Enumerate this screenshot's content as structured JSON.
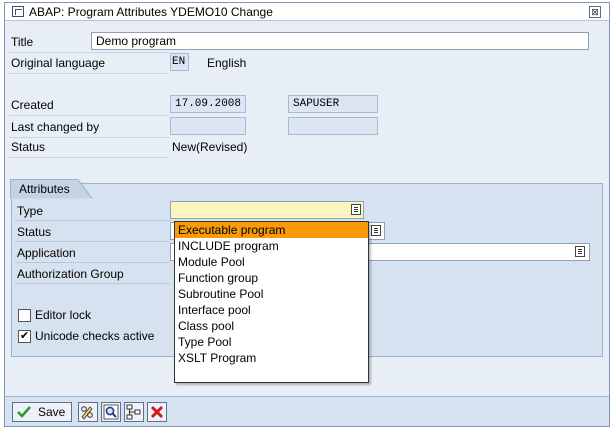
{
  "window": {
    "title": "ABAP: Program Attributes YDEMO10 Change",
    "close_glyph": "⊠"
  },
  "header_fields": {
    "title_label": "Title",
    "title_value": "Demo program",
    "orig_lang_label": "Original language",
    "orig_lang_code": "EN",
    "orig_lang_name": "English",
    "created_label": "Created",
    "created_date": "17.09.2008",
    "created_user": "SAPUSER",
    "last_changed_label": "Last changed by",
    "last_changed_date": "",
    "last_changed_user": "",
    "status_label": "Status",
    "status_value": "New(Revised)"
  },
  "attributes": {
    "group_label": "Attributes",
    "type_label": "Type",
    "type_value": "",
    "status_label": "Status",
    "application_label": "Application",
    "auth_group_label": "Authorization Group",
    "editor_lock_label": "Editor lock",
    "editor_lock_checked": false,
    "unicode_label": "Unicode checks active",
    "unicode_checked": true,
    "check_mark": "✔"
  },
  "type_dropdown": {
    "options": [
      "Executable program",
      "INCLUDE program",
      "Module Pool",
      "Function group",
      "Subroutine Pool",
      "Interface pool",
      "Class pool",
      "Type Pool",
      "XSLT Program"
    ],
    "highlighted_index": 0
  },
  "toolbar": {
    "save_label": "Save",
    "buttons": [
      "save",
      "object-list",
      "find",
      "display-object",
      "cancel"
    ]
  },
  "colors": {
    "highlight": "#f99a0a",
    "panel": "#d6e2ef",
    "active_field": "#fdf5c0"
  }
}
